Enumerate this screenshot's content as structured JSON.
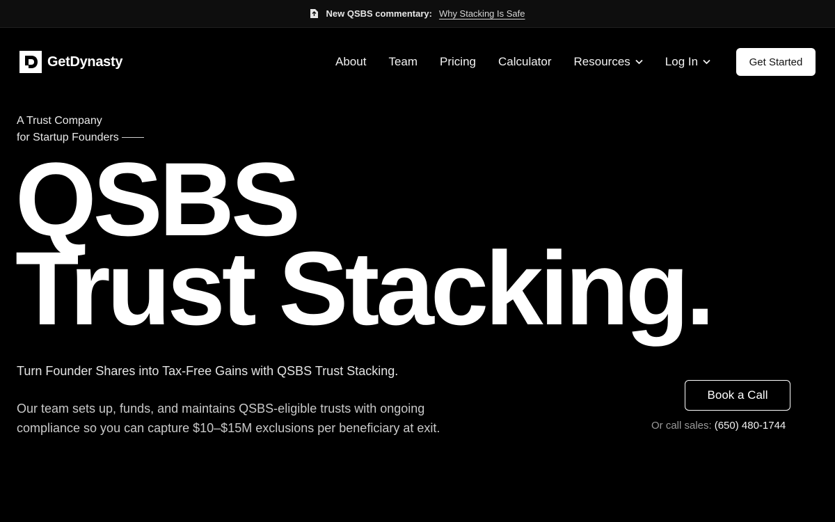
{
  "announcement": {
    "label": "New QSBS commentary:",
    "link_text": "Why Stacking Is Safe",
    "icon": "document-icon"
  },
  "brand": {
    "name": "GetDynasty",
    "logo_letter": "D"
  },
  "nav": {
    "items": [
      {
        "label": "About",
        "dropdown": false
      },
      {
        "label": "Team",
        "dropdown": false
      },
      {
        "label": "Pricing",
        "dropdown": false
      },
      {
        "label": "Calculator",
        "dropdown": false
      },
      {
        "label": "Resources",
        "dropdown": true
      },
      {
        "label": "Log In",
        "dropdown": true
      }
    ],
    "cta": "Get Started"
  },
  "hero": {
    "eyebrow_line1": "A Trust Company",
    "eyebrow_line2": "for Startup Founders",
    "headline_line1": "QSBS",
    "headline_line2": "Trust Stacking.",
    "subheadline": "Turn Founder Shares into Tax-Free Gains with QSBS Trust Stacking.",
    "description": "Our team sets up, funds, and maintains QSBS-eligible trusts with ongoing compliance so you can capture $10–$15M exclusions per beneficiary at exit.",
    "book_call": "Book a Call",
    "call_prefix": "Or call sales:",
    "phone": "(650) 480-1744"
  },
  "colors": {
    "background": "#000000",
    "text": "#ffffff",
    "announcement_bar": "#0e0e0e"
  }
}
